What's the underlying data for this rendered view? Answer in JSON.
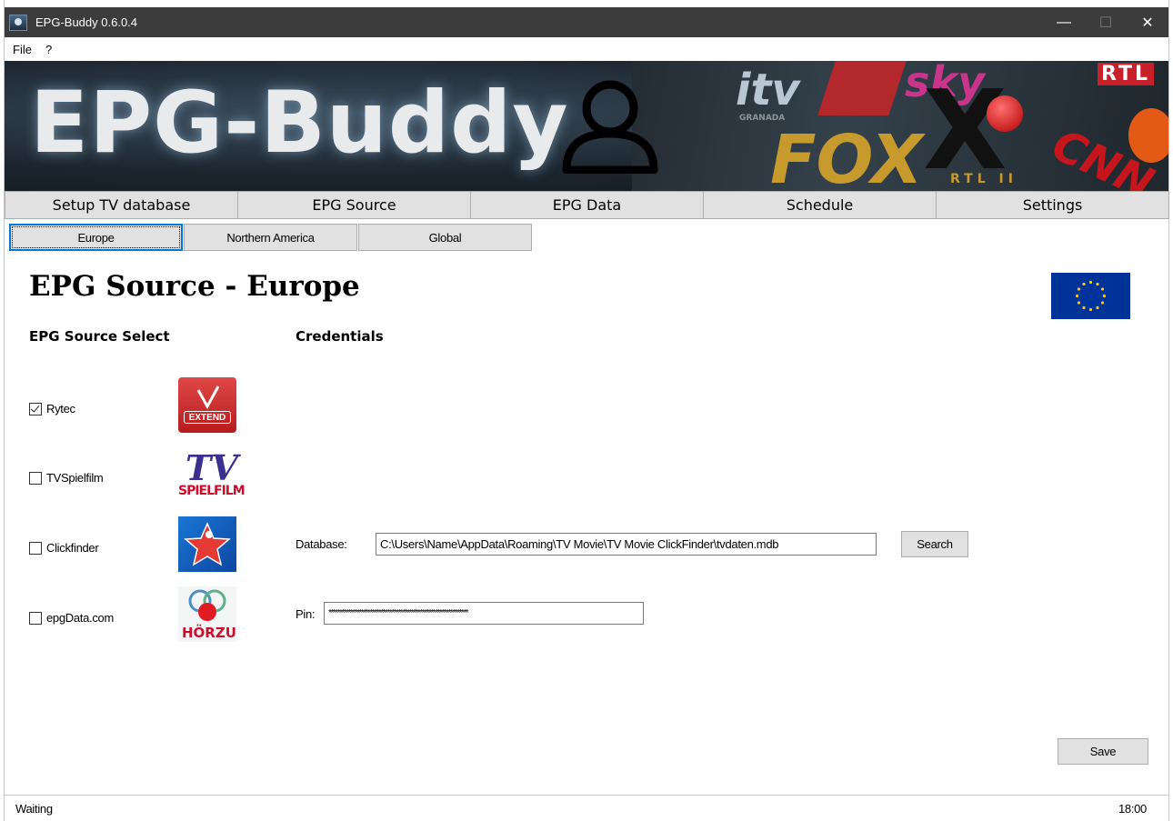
{
  "window": {
    "title": "EPG-Buddy 0.6.0.4",
    "minimize_glyph": "—",
    "maximize_glyph": "☐",
    "close_glyph": "✕"
  },
  "menu": [
    "File",
    "?"
  ],
  "banner": {
    "brand_text": "EPG-Buddy",
    "logos": [
      "itv",
      "GRANADA",
      "sky",
      "RTL",
      "FOX",
      "CNN",
      "RTL II"
    ]
  },
  "main_tabs": [
    "Setup TV database",
    "EPG Source",
    "EPG Data",
    "Schedule",
    "Settings"
  ],
  "sub_tabs": [
    "Europe",
    "Northern America",
    "Global"
  ],
  "active_sub_tab": "Europe",
  "page": {
    "title": "EPG Source - Europe",
    "source_select_heading": "EPG Source Select",
    "credentials_heading": "Credentials"
  },
  "sources": [
    {
      "label": "Rytec",
      "checked": true,
      "logo_text": "EXTEND",
      "logo_color": "#d42a2f"
    },
    {
      "label": "TVSpielfilm",
      "checked": false,
      "logo_text": "SPIELFILM",
      "logo_top": "TV",
      "logo_color": "#c8102e"
    },
    {
      "label": "Clickfinder",
      "checked": false,
      "logo_color": "#1565c0"
    },
    {
      "label": "epgData.com",
      "checked": false,
      "logo_text": "HÖRZU",
      "logo_color": "#c8102e"
    }
  ],
  "credentials": {
    "database_label": "Database:",
    "database_value": "C:\\Users\\Name\\AppData\\Roaming\\TV Movie\\TV Movie ClickFinder\\tvdaten.mdb",
    "search_button": "Search",
    "pin_label": "Pin:",
    "pin_value": "****************************************************************"
  },
  "save_button": "Save",
  "status": {
    "text": "Waiting",
    "time": "18:00"
  },
  "colors": {
    "titlebar": "#3c3c3c",
    "tab_bg": "#e1e1e1",
    "eu_blue": "#003399",
    "eu_gold": "#ffcc00"
  }
}
